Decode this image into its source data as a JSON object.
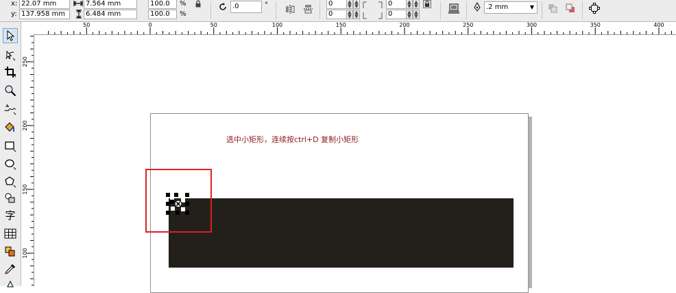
{
  "propbar": {
    "x_label": "x:",
    "x_value": "22.07 mm",
    "y_label": "y:",
    "y_value": "137.958 mm",
    "width_value": "7.564 mm",
    "height_value": "6.484 mm",
    "scale_w": "100.0",
    "scale_h": "100.0",
    "percent": "%",
    "rotation_value": ".0",
    "degree": "°",
    "corner_values": [
      "0",
      "0",
      "0",
      "0"
    ],
    "outline_width": ".2 mm"
  },
  "hruler": {
    "ticks": [
      {
        "label": "50",
        "mm": -50
      },
      {
        "label": "0",
        "mm": 0
      },
      {
        "label": "50",
        "mm": 50
      },
      {
        "label": "100",
        "mm": 100
      },
      {
        "label": "150",
        "mm": 150
      },
      {
        "label": "200",
        "mm": 200
      },
      {
        "label": "250",
        "mm": 250
      },
      {
        "label": "300",
        "mm": 300
      },
      {
        "label": "350",
        "mm": 350
      },
      {
        "label": "400",
        "mm": 400
      }
    ]
  },
  "vruler": {
    "ticks": [
      {
        "label": "250",
        "mm": 250
      },
      {
        "label": "200",
        "mm": 200
      },
      {
        "label": "150",
        "mm": 150
      },
      {
        "label": "100",
        "mm": 100
      }
    ]
  },
  "canvas": {
    "instruction_text": "选中小矩形，连续按ctrl+D 复制小矩形",
    "rect_fill": "#23201c",
    "highlight_color": "#e02020"
  },
  "tools": [
    "pick-tool-icon",
    "shape-tool-icon",
    "crop-tool-icon",
    "zoom-tool-icon",
    "freehand-tool-icon",
    "smart-fill-icon",
    "rectangle-tool-icon",
    "ellipse-tool-icon",
    "polygon-tool-icon",
    "basic-shapes-icon",
    "text-tool-icon",
    "table-tool-icon",
    "interactive-tool-icon",
    "eyedropper-tool-icon",
    "outline-pen-icon"
  ],
  "text_tool_glyph": "字"
}
